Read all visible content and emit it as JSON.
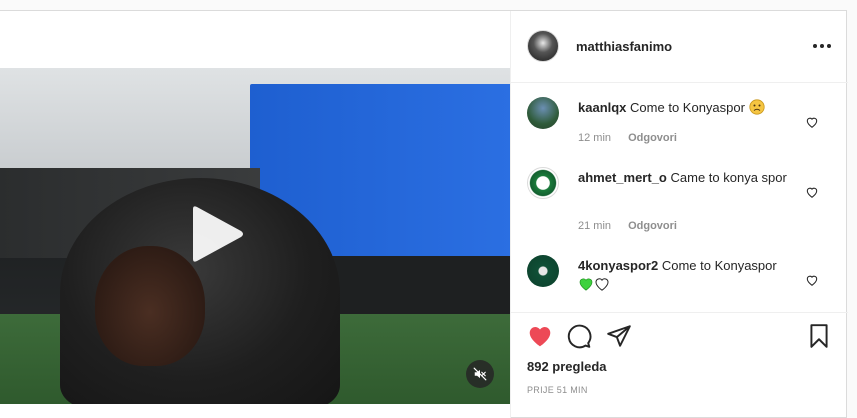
{
  "post": {
    "author": "matthiasfanimo",
    "views": "892 pregleda",
    "posted": "PRIJE 51 MIN"
  },
  "comments": [
    {
      "user": "kaanlqx",
      "text": "Come to Konyaspor",
      "emoji": "frowning-face",
      "time": "12 min",
      "reply": "Odgovori"
    },
    {
      "user": "ahmet_mert_o",
      "text": "Came to konya spor",
      "time": "21 min",
      "reply": "Odgovori"
    },
    {
      "user": "4konyaspor2",
      "text": "Come to Konyaspor",
      "emoji": "green-heart white-heart"
    }
  ],
  "colors": {
    "like_active": "#ed4956",
    "green_heart": "#3fd23f",
    "muted_text": "#8e8e8e"
  }
}
